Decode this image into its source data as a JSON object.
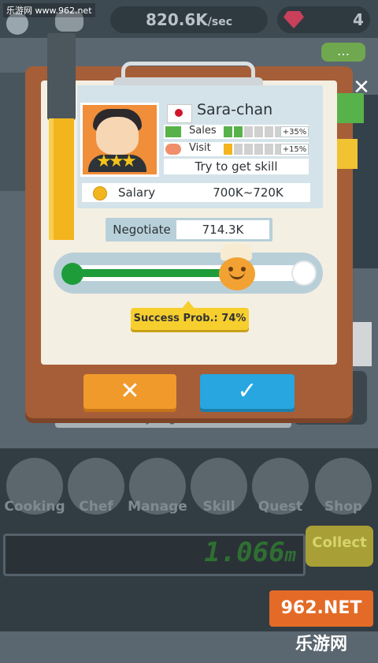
{
  "watermark_top": "乐游网 www.962.net",
  "topbar": {
    "income_rate": "820.6K",
    "income_unit": "/sec",
    "gem_count": "4"
  },
  "background": {
    "ghost_text": "Try to get skill"
  },
  "dialog": {
    "chef_name": "Sara-chan",
    "flag": "japan-flag-icon",
    "stats": [
      {
        "label": "Sales",
        "icon": "money-icon",
        "filled": 2,
        "total": 6,
        "fill_color": "#58b24a",
        "bonus": "+35%"
      },
      {
        "label": "Visit",
        "icon": "people-icon",
        "filled": 1,
        "total": 6,
        "fill_color": "#f2b51e",
        "bonus": "+15%"
      }
    ],
    "skill_prompt": "Try to get skill",
    "salary_label": "Salary",
    "salary_range": "700K~720K",
    "negotiate_label": "Negotiate",
    "negotiate_value": "714.3K",
    "slider_position_fraction": 0.68,
    "success_prob": "Success Prob.: 74%",
    "stars": 3
  },
  "nav": {
    "items": [
      {
        "label": "Cooking"
      },
      {
        "label": "Chef"
      },
      {
        "label": "Manage"
      },
      {
        "label": "Skill"
      },
      {
        "label": "Quest"
      },
      {
        "label": "Shop"
      }
    ]
  },
  "distance": {
    "value": "1.066",
    "unit": "m"
  },
  "collect_label": "Collect",
  "watermark_logo": "962.NET 乐游网",
  "colors": {
    "cancel": "#f09a2b",
    "confirm": "#27a6e0",
    "clipboard": "#a55e37",
    "slider_fill": "#1f9c3a"
  }
}
